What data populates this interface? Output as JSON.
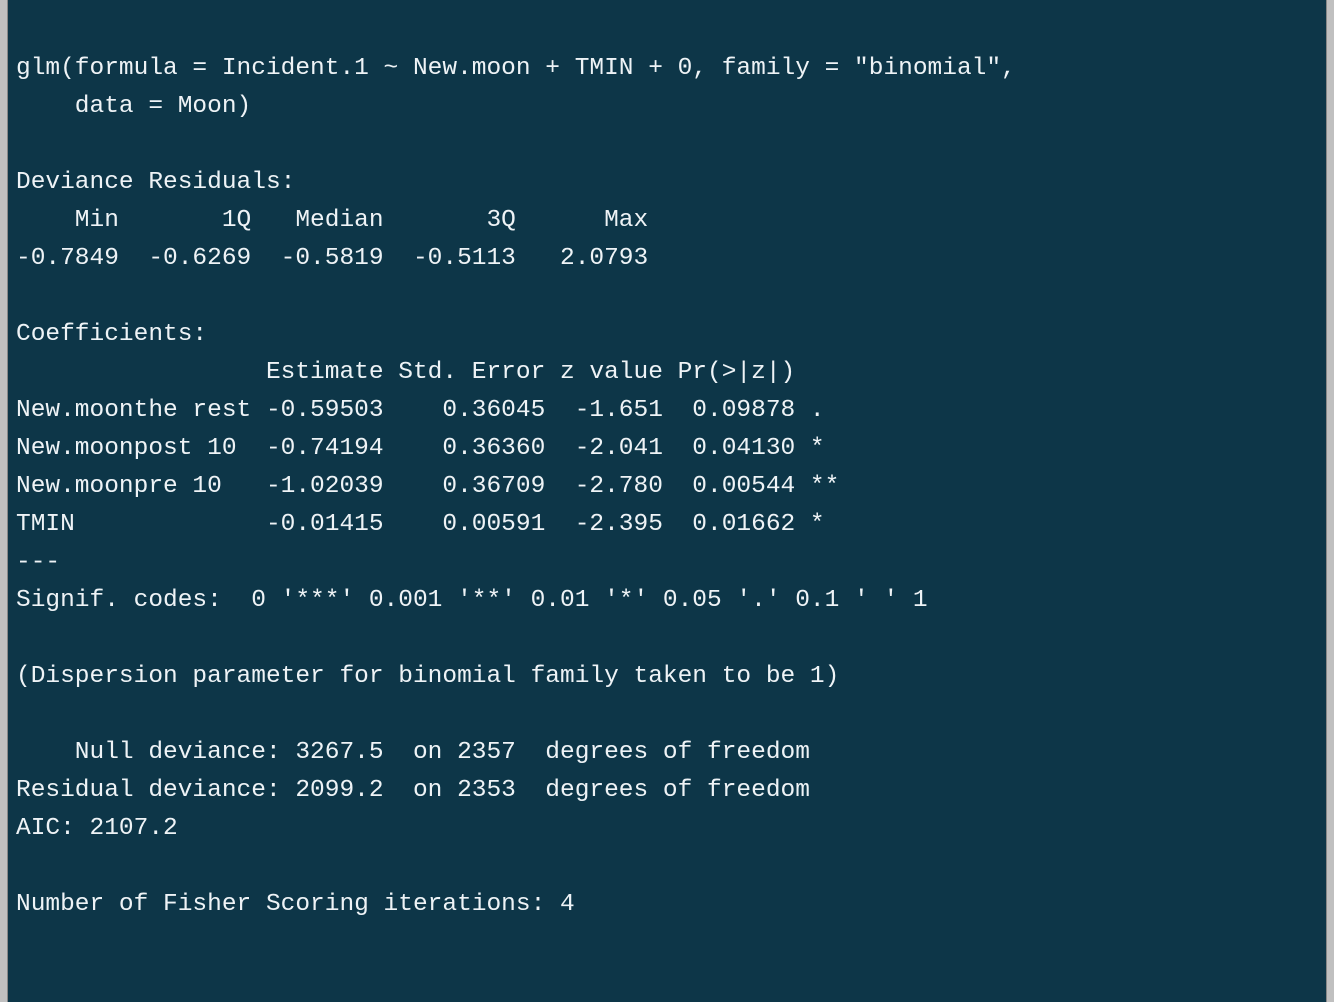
{
  "call_line1": "glm(formula = Incident.1 ~ New.moon + TMIN + 0, family = \"binomial\", ",
  "call_line2": "    data = Moon)",
  "devres_title": "Deviance Residuals: ",
  "devres_hdr": "    Min       1Q   Median       3Q      Max  ",
  "devres_vals": "-0.7849  -0.6269  -0.5819  -0.5113   2.0793  ",
  "coef_title": "Coefficients:",
  "coef_hdr": "                 Estimate Std. Error z value Pr(>|z|)   ",
  "coef_row1": "New.moonthe rest -0.59503    0.36045  -1.651  0.09878 . ",
  "coef_row2": "New.moonpost 10  -0.74194    0.36360  -2.041  0.04130 * ",
  "coef_row3": "New.moonpre 10   -1.02039    0.36709  -2.780  0.00544 **",
  "coef_row4": "TMIN             -0.01415    0.00591  -2.395  0.01662 * ",
  "sep": "---",
  "signif": "Signif. codes:  0 '***' 0.001 '**' 0.01 '*' 0.05 '.' 0.1 ' ' 1",
  "dispersion": "(Dispersion parameter for binomial family taken to be 1)",
  "null_dev": "    Null deviance: 3267.5  on 2357  degrees of freedom",
  "resid_dev": "Residual deviance: 2099.2  on 2353  degrees of freedom",
  "aic": "AIC: 2107.2",
  "fisher": "Number of Fisher Scoring iterations: 4"
}
